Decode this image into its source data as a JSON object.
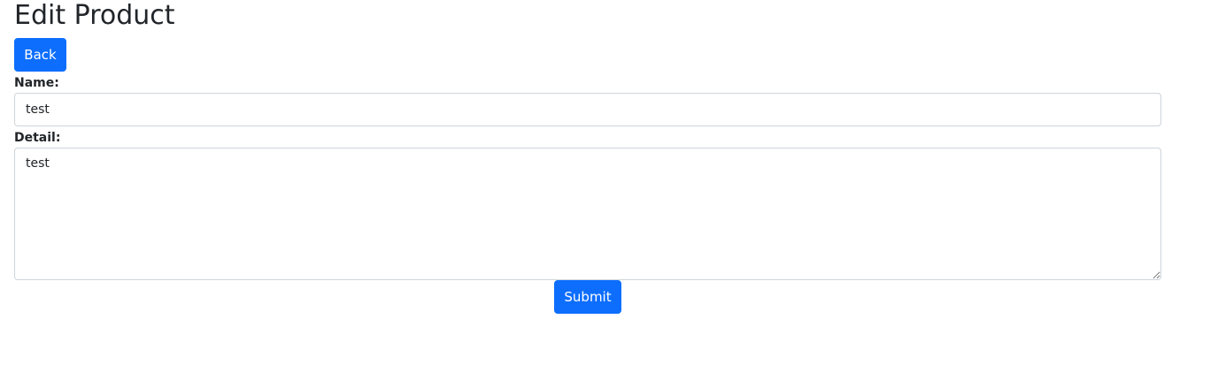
{
  "page": {
    "title": "Edit Product"
  },
  "actions": {
    "back_label": "Back",
    "submit_label": "Submit"
  },
  "form": {
    "name_label": "Name:",
    "name_value": "test",
    "detail_label": "Detail:",
    "detail_value": "test"
  },
  "colors": {
    "primary": "#0d6efd",
    "text": "#212529",
    "input_border": "#ced4da"
  }
}
